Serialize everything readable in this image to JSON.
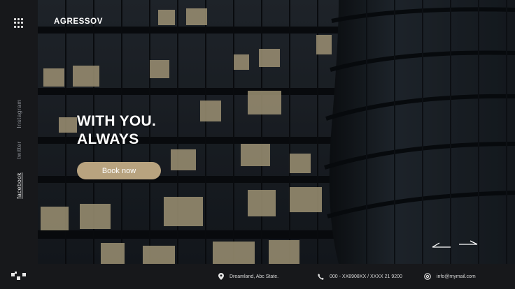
{
  "brand": {
    "name": "AGRESSOV"
  },
  "hero": {
    "headline_line1": "WITH YOU.",
    "headline_line2": "ALWAYS",
    "cta_label": "Book now"
  },
  "sidebar": {
    "social": [
      {
        "label": "Instagram",
        "active": false
      },
      {
        "label": "twitter",
        "active": false
      },
      {
        "label": "facebook",
        "active": true
      }
    ]
  },
  "footer": {
    "address": "Dreamland, Abc State.",
    "phone": "000 - XX8908XX / XXXX 21 9200",
    "email": "info@mymail.com"
  },
  "icons": {
    "menu": "grid-menu-icon",
    "logo": "logo-mark-icon",
    "location": "location-pin-icon",
    "phone": "phone-icon",
    "email": "at-sign-icon",
    "prev": "arrow-left-icon",
    "next": "arrow-right-icon"
  },
  "colors": {
    "accent": "#b8a37f",
    "sidebar_bg": "#17181b",
    "window_light": "#d9c9a0"
  }
}
